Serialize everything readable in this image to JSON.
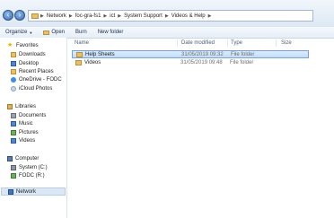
{
  "address": {
    "segments": [
      "Network",
      "foc-gra-fs1",
      "ict",
      "System Support",
      "Videos & Help"
    ]
  },
  "toolbar": {
    "organize": "Organize",
    "open": "Open",
    "burn": "Burn",
    "new_folder": "New folder"
  },
  "nav": {
    "favorites": "Favorites",
    "downloads": "Downloads",
    "desktop": "Desktop",
    "recent_places": "Recent Places",
    "onedrive": "OneDrive - FODC",
    "icloud": "iCloud Photos",
    "libraries": "Libraries",
    "documents": "Documents",
    "music": "Music",
    "pictures": "Pictures",
    "videos": "Videos",
    "computer": "Computer",
    "system_c": "System (C:)",
    "fodc_r": "FODC (R:)",
    "network": "Network"
  },
  "columns": {
    "name": "Name",
    "date": "Date modified",
    "type": "Type",
    "size": "Size"
  },
  "files": [
    {
      "name": "Help Sheets",
      "date": "31/05/2019 09:32",
      "type": "File folder"
    },
    {
      "name": "Videos",
      "date": "31/05/2019 09:48",
      "type": "File folder"
    }
  ]
}
